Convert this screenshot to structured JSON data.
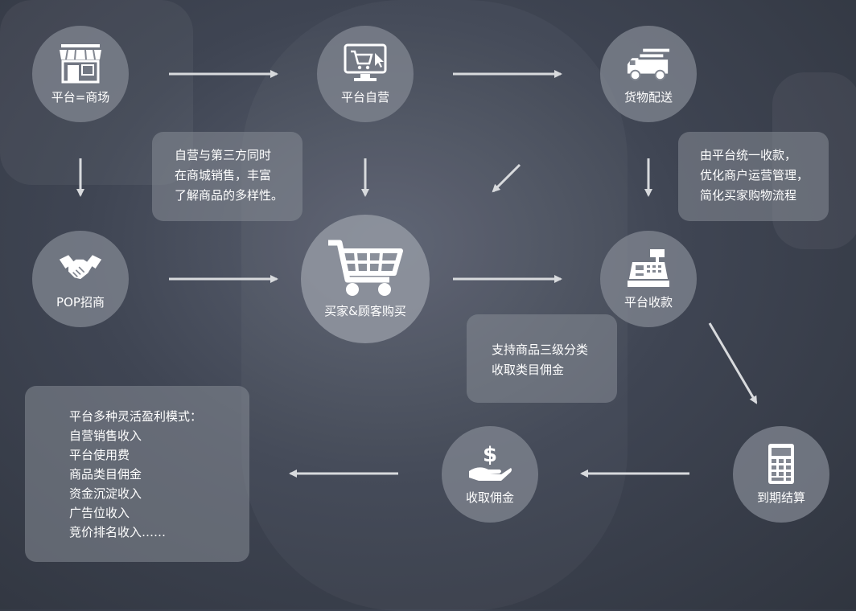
{
  "nodes": {
    "platform_mall": "平台=商场",
    "self_operated": "平台自营",
    "delivery": "货物配送",
    "pop": "POP招商",
    "buyers": "买家&顾客购买",
    "collection": "平台收款",
    "settlement": "到期结算",
    "commission": "收取佣金"
  },
  "boxes": {
    "variety": [
      "自营与第三方同时",
      "在商城销售，丰富",
      "了解商品的多样性。"
    ],
    "unified": [
      "由平台统一收款，",
      "优化商户运营管理，",
      "简化买家购物流程"
    ],
    "category": [
      "支持商品三级分类",
      "收取类目佣金"
    ],
    "profit": [
      "平台多种灵活盈利模式：",
      "自营销售收入",
      "平台使用费",
      "商品类目佣金",
      "资金沉淀收入",
      "广告位收入",
      "竞价排名收入……"
    ]
  },
  "icons": {
    "platform_mall": "storefront-icon",
    "self_operated": "monitor-cart-icon",
    "delivery": "truck-icon",
    "pop": "handshake-icon",
    "buyers": "shopping-cart-icon",
    "collection": "cash-register-icon",
    "settlement": "calculator-icon",
    "commission": "money-hand-icon"
  }
}
